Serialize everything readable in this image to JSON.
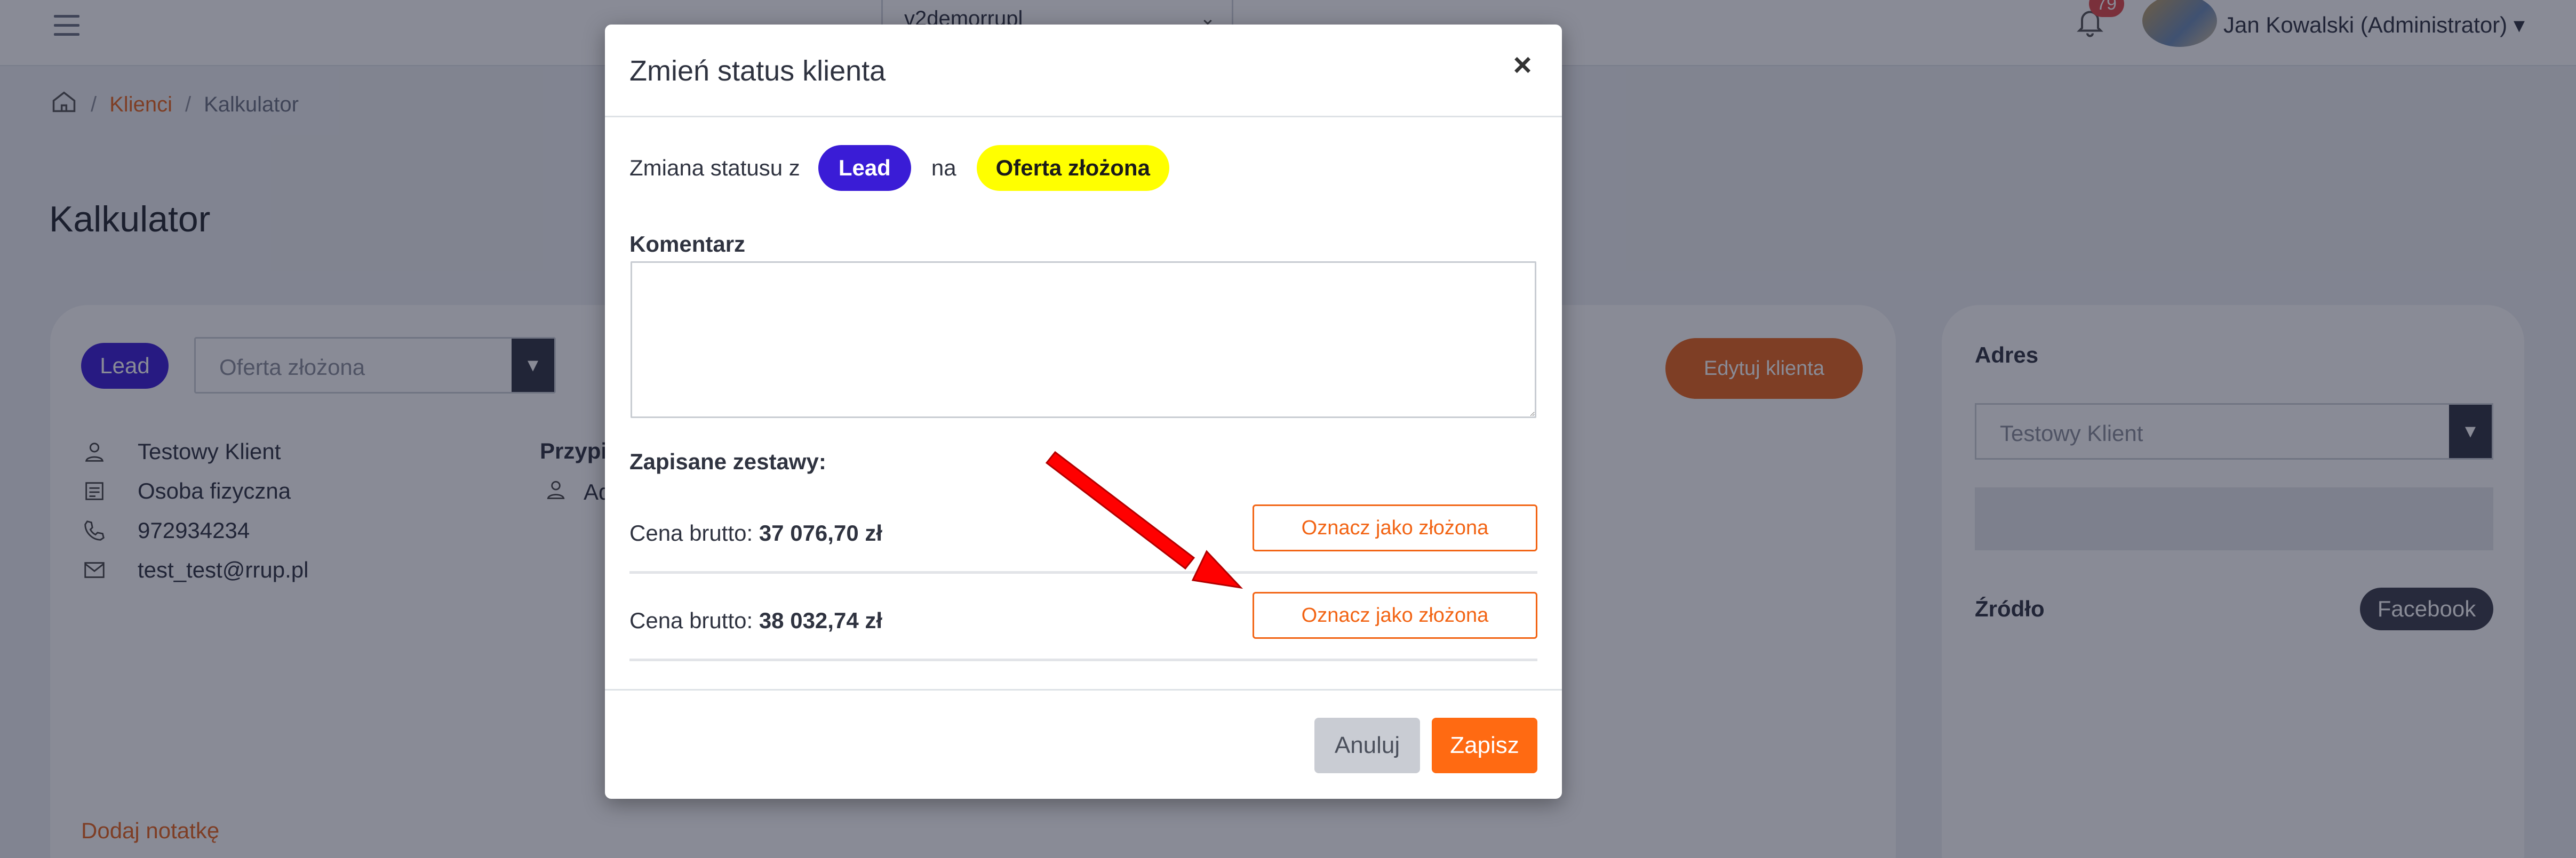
{
  "topbar": {
    "menu_icon": "hamburger-icon",
    "select_value": "v2demorrupl",
    "notification_count": "79",
    "user_name": "Jan Kowalski (Administrator)"
  },
  "breadcrumb": {
    "home_icon": "home-icon",
    "sep": "/",
    "clients": "Klienci",
    "current": "Kalkulator"
  },
  "page": {
    "title": "Kalkulator",
    "status_pill": "Lead",
    "status_select": "Oferta złożona",
    "edit_client": "Edytuj klienta",
    "client_name": "Testowy Klient",
    "client_type": "Osoba fizyczna",
    "phone": "972934234",
    "email": "test_test@rrup.pl",
    "assigned_label": "Przypi",
    "assigned_value": "Adr",
    "add_note": "Dodaj notatkę"
  },
  "side": {
    "address_label": "Adres",
    "address_select": "Testowy Klient",
    "source_label": "Źródło",
    "source_value": "Facebook"
  },
  "modal": {
    "title": "Zmień status klienta",
    "close": "×",
    "change_prefix": "Zmiana statusu z",
    "from_status": "Lead",
    "to_word": "na",
    "to_status": "Oferta złożona",
    "comment_label": "Komentarz",
    "comment_value": "",
    "sets_label": "Zapisane zestawy:",
    "sets": [
      {
        "price_label": "Cena brutto:",
        "price": "37 076,70 zł",
        "button": "Oznacz jako złożona"
      },
      {
        "price_label": "Cena brutto:",
        "price": "38 032,74 zł",
        "button": "Oznacz jako złożona"
      }
    ],
    "cancel": "Anuluj",
    "save": "Zapisz"
  },
  "colors": {
    "accent": "#f26414",
    "lead": "#3a1cd6",
    "offer": "#ffff00",
    "arrow": "#ff0000"
  }
}
